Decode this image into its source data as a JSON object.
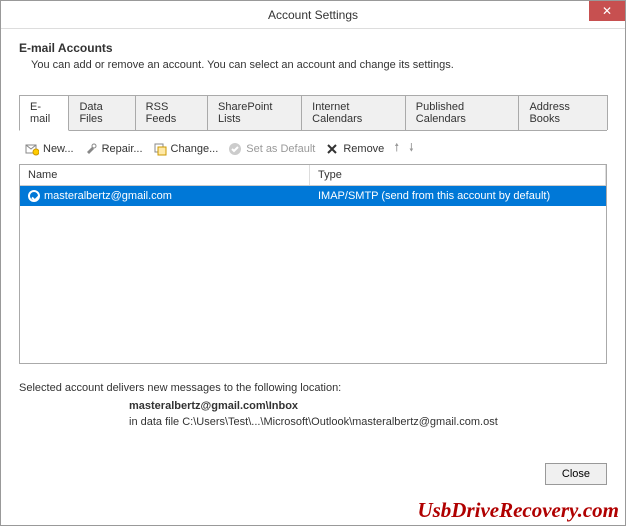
{
  "window": {
    "title": "Account Settings",
    "close_symbol": "✕"
  },
  "header": {
    "title": "E-mail Accounts",
    "subtitle": "You can add or remove an account. You can select an account and change its settings."
  },
  "tabs": [
    {
      "label": "E-mail",
      "active": true
    },
    {
      "label": "Data Files"
    },
    {
      "label": "RSS Feeds"
    },
    {
      "label": "SharePoint Lists"
    },
    {
      "label": "Internet Calendars"
    },
    {
      "label": "Published Calendars"
    },
    {
      "label": "Address Books"
    }
  ],
  "toolbar": {
    "new": "New...",
    "repair": "Repair...",
    "change": "Change...",
    "set_default": "Set as Default",
    "remove": "Remove"
  },
  "list": {
    "columns": {
      "name": "Name",
      "type": "Type"
    },
    "rows": [
      {
        "name": "masteralbertz@gmail.com",
        "type": "IMAP/SMTP (send from this account by default)"
      }
    ]
  },
  "info": {
    "label": "Selected account delivers new messages to the following location:",
    "location": "masteralbertz@gmail.com\\Inbox",
    "datafile": "in data file C:\\Users\\Test\\...\\Microsoft\\Outlook\\masteralbertz@gmail.com.ost"
  },
  "footer": {
    "close": "Close"
  },
  "watermark": "UsbDriveRecovery.com"
}
